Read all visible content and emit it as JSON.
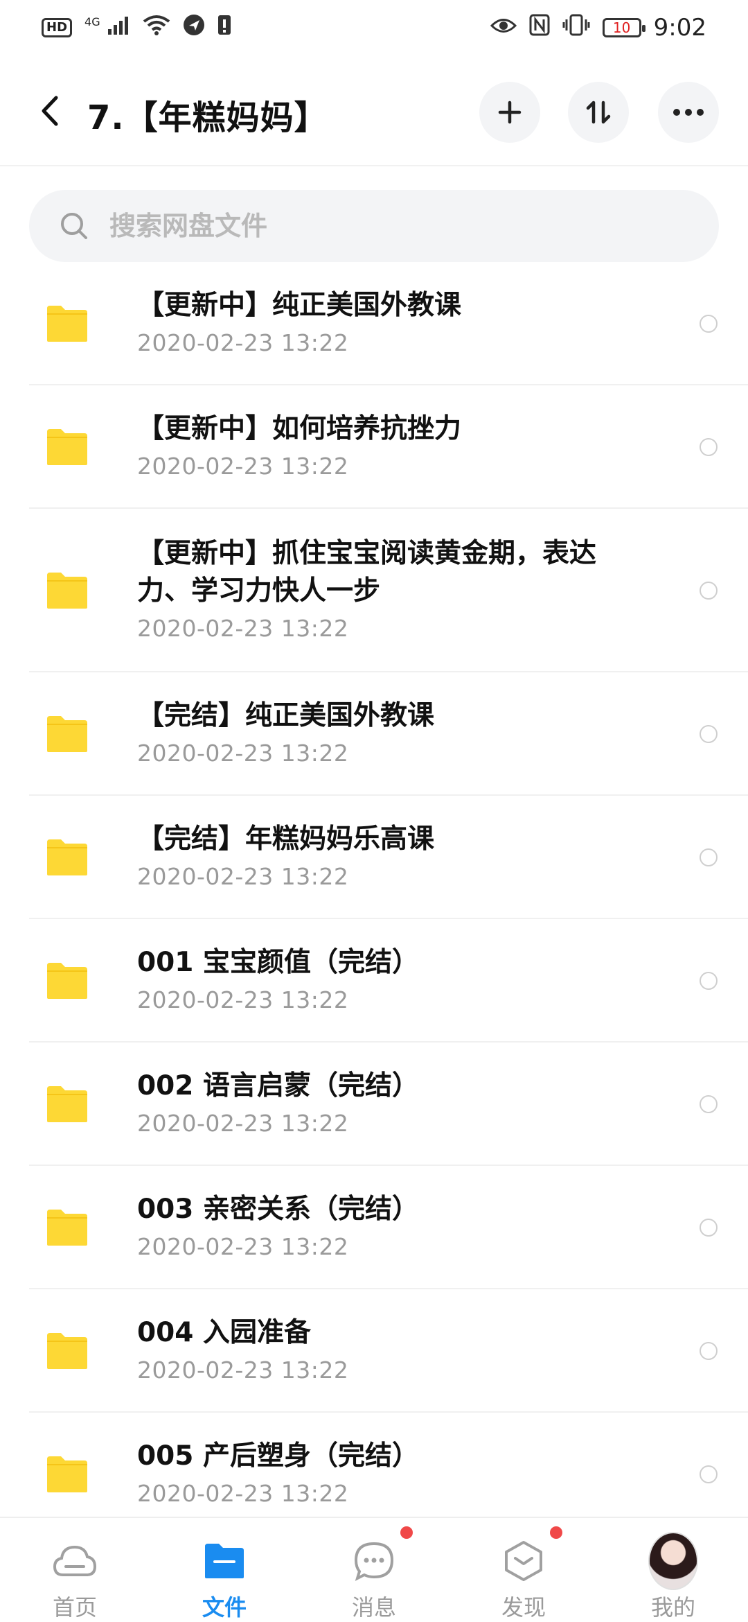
{
  "status_bar": {
    "hd": "HD",
    "network": "4G",
    "battery": "10",
    "time": "9:02"
  },
  "header": {
    "title": "7.【年糕妈妈】",
    "add_icon": "plus-icon",
    "sort_icon": "sort-icon",
    "more_icon": "more-icon"
  },
  "search": {
    "placeholder": "搜索网盘文件"
  },
  "files": [
    {
      "name": "【更新中】纯正美国外教课",
      "date": "2020-02-23  13:22"
    },
    {
      "name": "【更新中】如何培养抗挫力",
      "date": "2020-02-23  13:22"
    },
    {
      "name": "【更新中】抓住宝宝阅读黄金期，表达力、学习力快人一步",
      "date": "2020-02-23  13:22"
    },
    {
      "name": "【完结】纯正美国外教课",
      "date": "2020-02-23  13:22"
    },
    {
      "name": "【完结】年糕妈妈乐高课",
      "date": "2020-02-23  13:22"
    },
    {
      "name": "001 宝宝颜值（完结）",
      "date": "2020-02-23  13:22"
    },
    {
      "name": "002 语言启蒙（完结）",
      "date": "2020-02-23  13:22"
    },
    {
      "name": "003 亲密关系（完结）",
      "date": "2020-02-23  13:22"
    },
    {
      "name": "004 入园准备",
      "date": "2020-02-23  13:22"
    },
    {
      "name": "005 产后塑身（完结）",
      "date": "2020-02-23  13:22"
    }
  ],
  "nav": [
    {
      "label": "首页",
      "icon": "cloud-icon"
    },
    {
      "label": "文件",
      "icon": "folder-icon"
    },
    {
      "label": "消息",
      "icon": "message-icon"
    },
    {
      "label": "发现",
      "icon": "discover-icon"
    },
    {
      "label": "我的",
      "icon": "avatar"
    }
  ],
  "colors": {
    "accent": "#1a8cf0",
    "folder": "#fdd835",
    "badge": "#f04848"
  }
}
